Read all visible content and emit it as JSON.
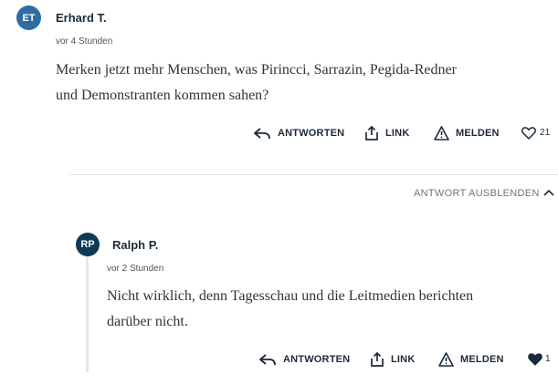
{
  "colors": {
    "avatar_et": "#2e6da4",
    "avatar_rp": "#0f3a55",
    "text": "#1b2a3a"
  },
  "comment1": {
    "avatar_initials": "ET",
    "author": "Erhard T.",
    "time": "vor 4 Stunden",
    "line1": "Merken jetzt mehr Menschen, was Pirincci, Sarrazin, Pegida-Redner",
    "line2": "und Demonstranten kommen sahen?",
    "actions": {
      "reply": "ANTWORTEN",
      "link": "LINK",
      "report": "MELDEN",
      "likes": "21"
    }
  },
  "hide_replies_label": "ANTWORT AUSBLENDEN",
  "comment2": {
    "avatar_initials": "RP",
    "author": "Ralph P.",
    "time": "vor 2 Stunden",
    "line1": "Nicht wirklich, denn Tagesschau und die Leitmedien berichten",
    "line2": "darüber nicht.",
    "actions": {
      "reply": "ANTWORTEN",
      "link": "LINK",
      "report": "MELDEN",
      "likes": "1"
    }
  }
}
